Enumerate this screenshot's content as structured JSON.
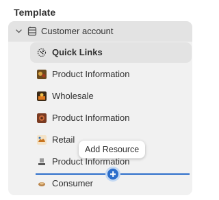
{
  "panel": {
    "heading": "Template",
    "section": {
      "label": "Customer account",
      "expanded": true
    },
    "items": [
      {
        "label": "Quick Links",
        "icon": "quick-links-icon",
        "selected": true
      },
      {
        "label": "Product Information",
        "icon": "product-thumbnail-icon",
        "selected": false
      },
      {
        "label": "Wholesale",
        "icon": "wholesale-thumbnail-icon",
        "selected": false
      },
      {
        "label": "Product Information",
        "icon": "product-thumbnail-icon",
        "selected": false
      },
      {
        "label": "Retail",
        "icon": "retail-thumbnail-icon",
        "selected": false
      },
      {
        "label": "Product Information",
        "icon": "product-thumbnail-icon",
        "selected": false
      },
      {
        "label": "Consumer",
        "icon": "consumer-thumbnail-icon",
        "selected": false
      }
    ]
  },
  "tooltip": {
    "text": "Add Resource"
  },
  "colors": {
    "accent": "#2c6ecb",
    "panel_bg": "#f1f1f1",
    "selected_bg": "#e3e3e3"
  }
}
